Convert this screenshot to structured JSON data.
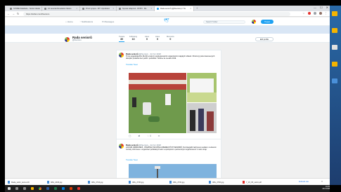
{
  "browser": {
    "tabs": [
      {
        "title": "STOBE Databaze - Senior Hlede"
      },
      {
        "title": "21 veverek Revelation Mesto"
      },
      {
        "title": "Prvni vyrupa - KIT vzprodukci"
      },
      {
        "title": "Spusta vklapnuti - RVPO - Ms"
      },
      {
        "title": "Rada seniorů (@Ifsenioru) / Tw"
      }
    ],
    "new_tab": "+",
    "window_controls": [
      "—",
      "☐",
      "✕"
    ],
    "url": "https://twitter.com/Ifsenioru"
  },
  "twitter": {
    "nav": {
      "home": "Home",
      "notifications": "Notifications",
      "messages": "Messages"
    },
    "search_placeholder": "Search Twitter",
    "tweet_button": "Tweet",
    "profile": {
      "name": "Rada seniorů",
      "handle": "@Ifsenioru",
      "edit_button": "Edit profile",
      "stats": [
        {
          "label": "Tweets",
          "value": "30"
        },
        {
          "label": "Following",
          "value": "13"
        },
        {
          "label": "Likes",
          "value": "0"
        },
        {
          "label": "Likes",
          "value": "0"
        },
        {
          "label": "Moments",
          "value": "0"
        }
      ]
    },
    "tweets": [
      {
        "name": "Rada seniorů",
        "meta": "@Ifsenioru · 22 čvn 2018",
        "text": "Tímto organizátorům RLCR a četným spolupracujícím organizacím krajských oblastí. Ohromný počet stanovených disciplín proběhlo bez potíží i pohodlně. Těšíme se na akci 2019.",
        "link": "Translate Tweet",
        "actions": [
          "◯",
          "⇄",
          "♡ 4",
          "✉"
        ]
      },
      {
        "name": "Rada seniorů",
        "meta": "@Ifsenioru · 22 čvn 2018",
        "text": "LIDOVÉ OZBROJENÍ - PRAŽSKÁ SKUPINA LIBERECKÝCH SENIORŮ. Na fotografii zachyceno setkání, na kterém zazněly informace o organizaci pořádaných akcí a spolupráci s partnerskými organizacemi v celém kraji.",
        "link": "Translate Tweet"
      }
    ]
  },
  "downloads": [
    {
      "name": "Rada_stolni_tenis.crdt"
    },
    {
      "name": "IMG_2046.jpg"
    },
    {
      "name": "IMG_2744.jpg"
    },
    {
      "name": "IMG_2745.jpg"
    },
    {
      "name": "IMG_2733.jpg"
    },
    {
      "name": "IMG_2766.jpg"
    },
    {
      "name": "7_15_05_stolni.pdf"
    }
  ],
  "download_show_all": "Zobrazit vše",
  "clock": {
    "time": "16:25",
    "date": "22.6.2018"
  }
}
